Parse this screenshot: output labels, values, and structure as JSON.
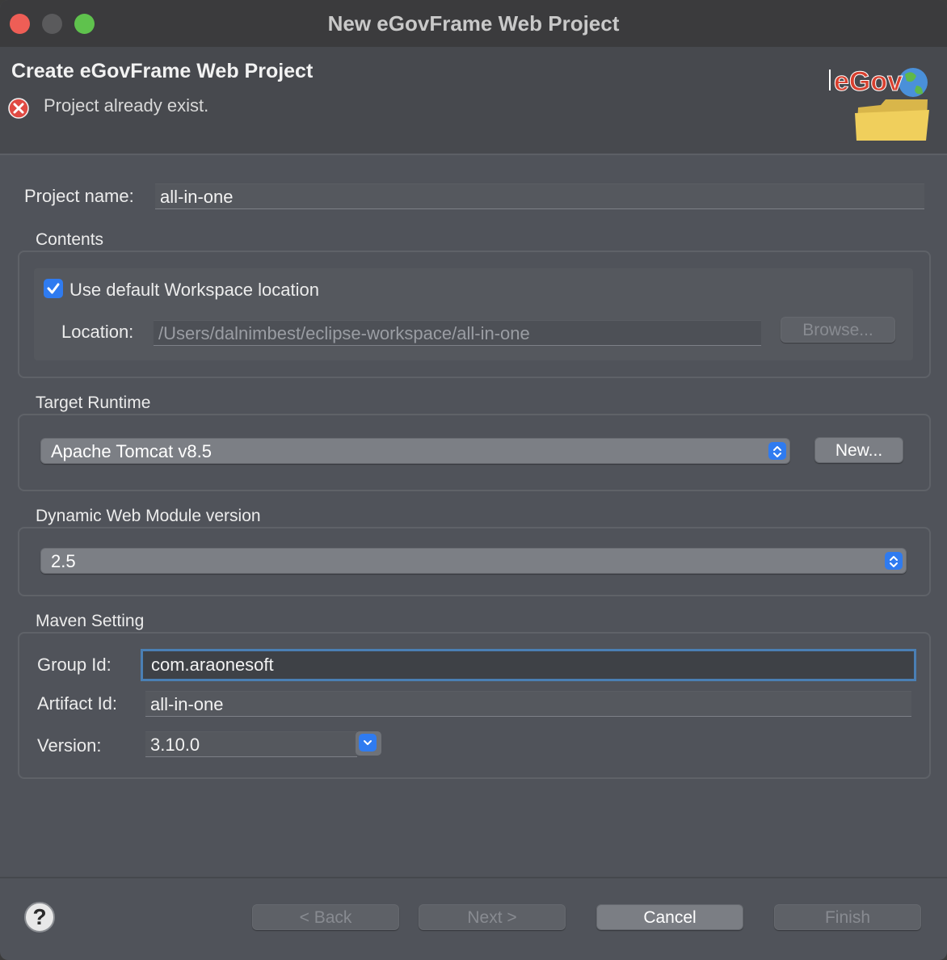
{
  "window": {
    "title": "New eGovFrame Web Project"
  },
  "header": {
    "title": "Create eGovFrame Web Project",
    "message": "Project already exist.",
    "logo_text": "eGov"
  },
  "project": {
    "name_label": "Project name:",
    "name_value": "all-in-one"
  },
  "contents": {
    "title": "Contents",
    "use_default_label": "Use default Workspace location",
    "use_default_checked": true,
    "location_label": "Location:",
    "location_value": "/Users/dalnimbest/eclipse-workspace/all-in-one",
    "browse_label": "Browse..."
  },
  "target_runtime": {
    "title": "Target Runtime",
    "selected": "Apache Tomcat v8.5",
    "new_label": "New..."
  },
  "dynamic_web_module": {
    "title": "Dynamic Web Module version",
    "selected": "2.5"
  },
  "maven": {
    "title": "Maven Setting",
    "group_label": "Group Id:",
    "group_value": "com.araonesoft",
    "artifact_label": "Artifact Id:",
    "artifact_value": "all-in-one",
    "version_label": "Version:",
    "version_value": "3.10.0"
  },
  "footer": {
    "help": "?",
    "back_label": "< Back",
    "next_label": "Next >",
    "cancel_label": "Cancel",
    "finish_label": "Finish"
  },
  "colors": {
    "accent": "#2f7bf0",
    "error": "#e04a43",
    "focus": "#4a7fb4"
  }
}
